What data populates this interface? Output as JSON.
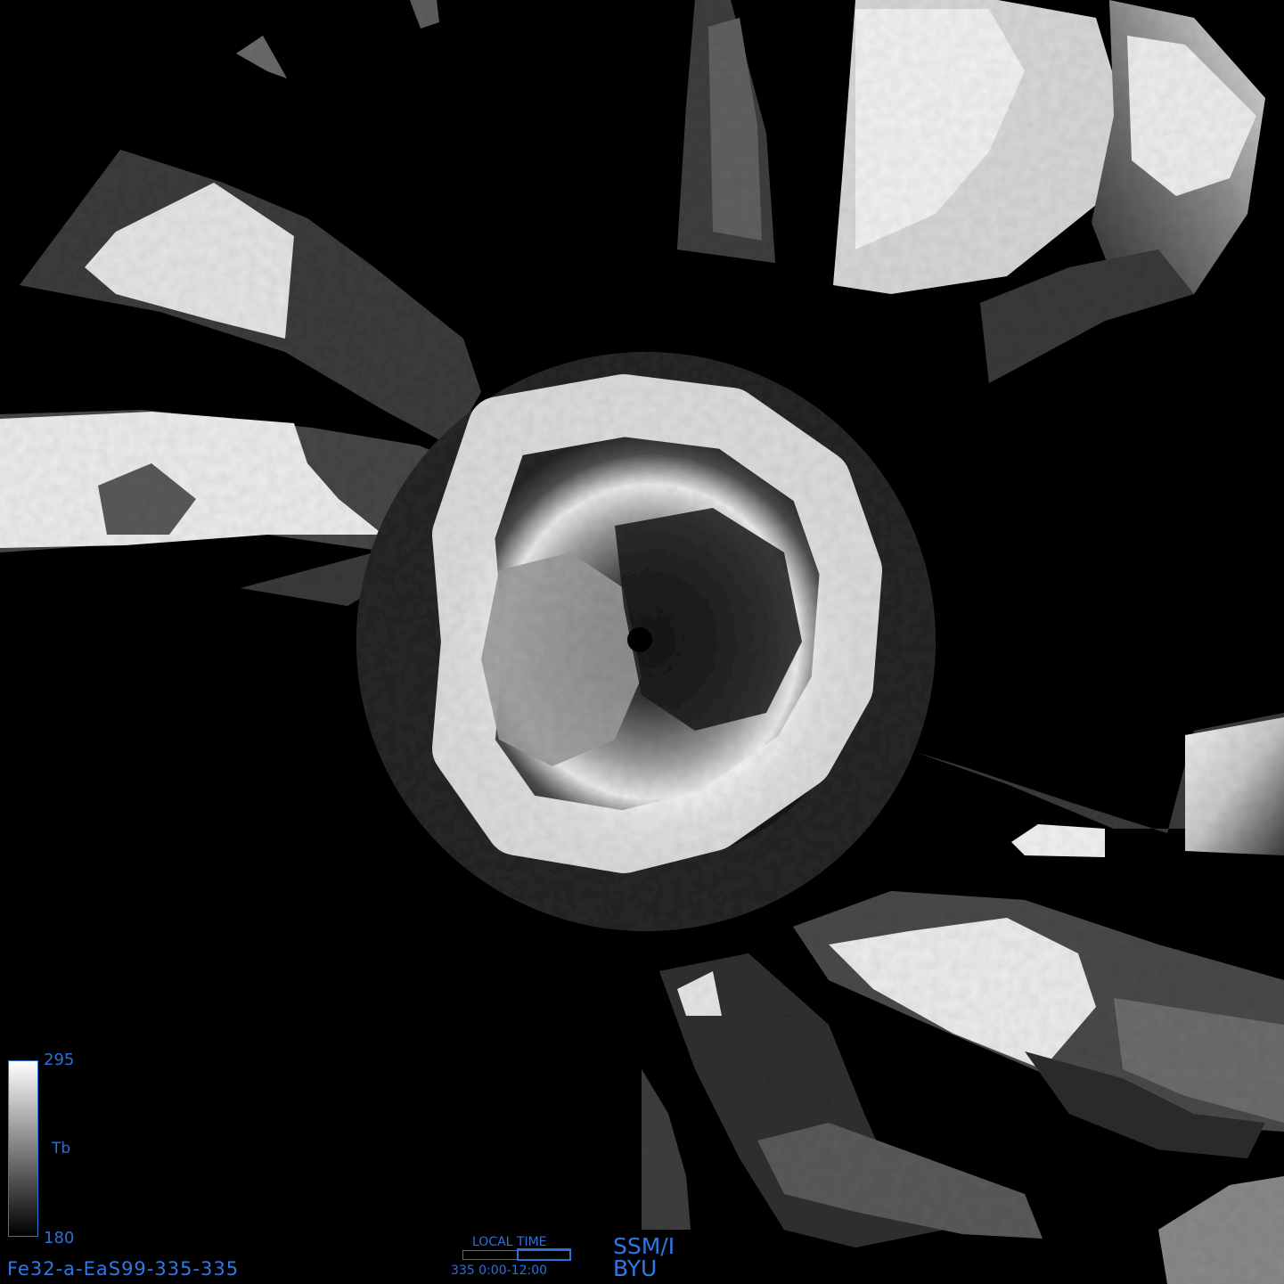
{
  "image": {
    "id": "Fe32-a-EaS99-335-335",
    "sensor": "SSM/I",
    "organization": "BYU"
  },
  "colorbar": {
    "max_label": "295",
    "min_label": "180",
    "unit_label": "Tb",
    "colors": [
      "#000000",
      "#ffffff"
    ]
  },
  "local_time": {
    "label": "LOCAL TIME",
    "range_text": "335  0:00-12:00",
    "fraction_covered": 0.5
  },
  "colors": {
    "annotation": "#2f6fd6",
    "background": "#000000"
  }
}
